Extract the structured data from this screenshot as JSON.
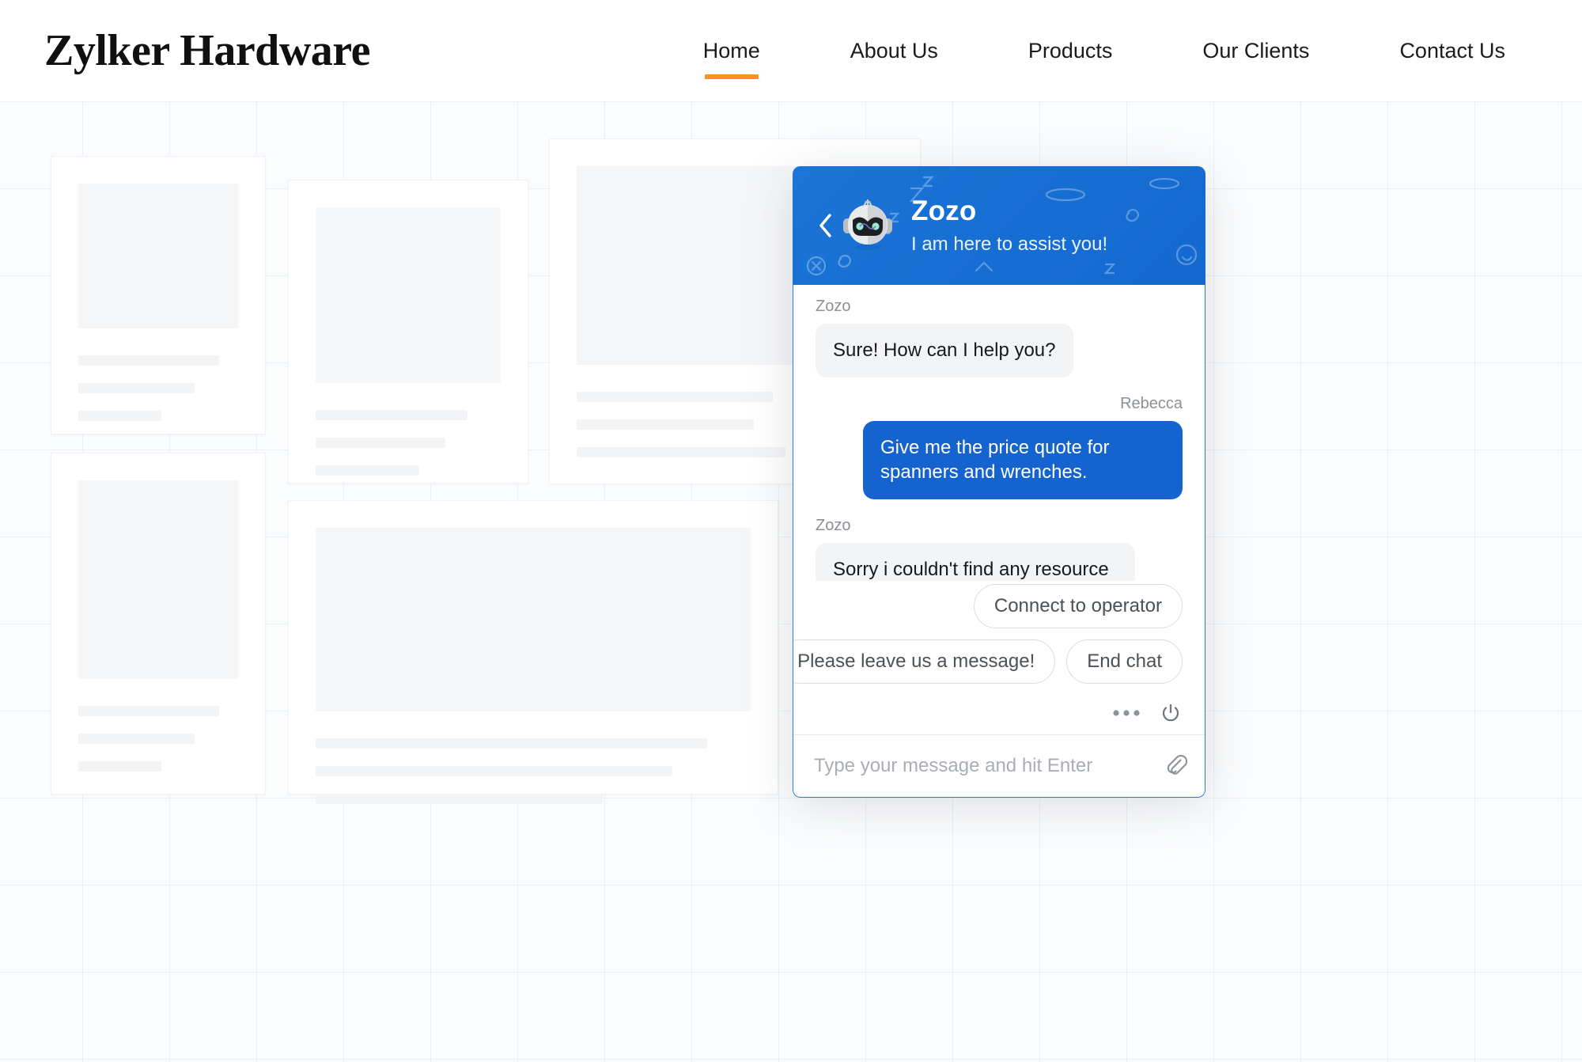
{
  "site": {
    "brand": "Zylker Hardware",
    "nav": [
      {
        "label": "Home",
        "active": true
      },
      {
        "label": "About Us",
        "active": false
      },
      {
        "label": "Products",
        "active": false
      },
      {
        "label": "Our Clients",
        "active": false
      },
      {
        "label": "Contact Us",
        "active": false
      }
    ],
    "accent_color": "#f7941d"
  },
  "chat": {
    "title": "Zozo",
    "subtitle": "I am here to assist you!",
    "header_color": "#1a73d4",
    "bot_name": "Zozo",
    "user_name": "Rebecca",
    "messages": [
      {
        "sender": "Zozo",
        "side": "left",
        "text": "Sure! How can I help you?"
      },
      {
        "sender": "Rebecca",
        "side": "right",
        "text": "Give me the price quote for spanners and wrenches."
      },
      {
        "sender": "Zozo",
        "side": "left",
        "text": "Sorry i couldn't find any resource to your search"
      }
    ],
    "suggestions": [
      {
        "label": "Connect to operator"
      },
      {
        "label": "Please leave us a message!"
      },
      {
        "label": "End chat"
      }
    ],
    "input_placeholder": "Type your message and hit Enter",
    "input_value": "",
    "icons": {
      "back": "chevron-left-icon",
      "avatar": "robot-avatar-icon",
      "more": "more-options-icon",
      "power": "end-session-power-icon",
      "attach": "paperclip-icon"
    }
  }
}
